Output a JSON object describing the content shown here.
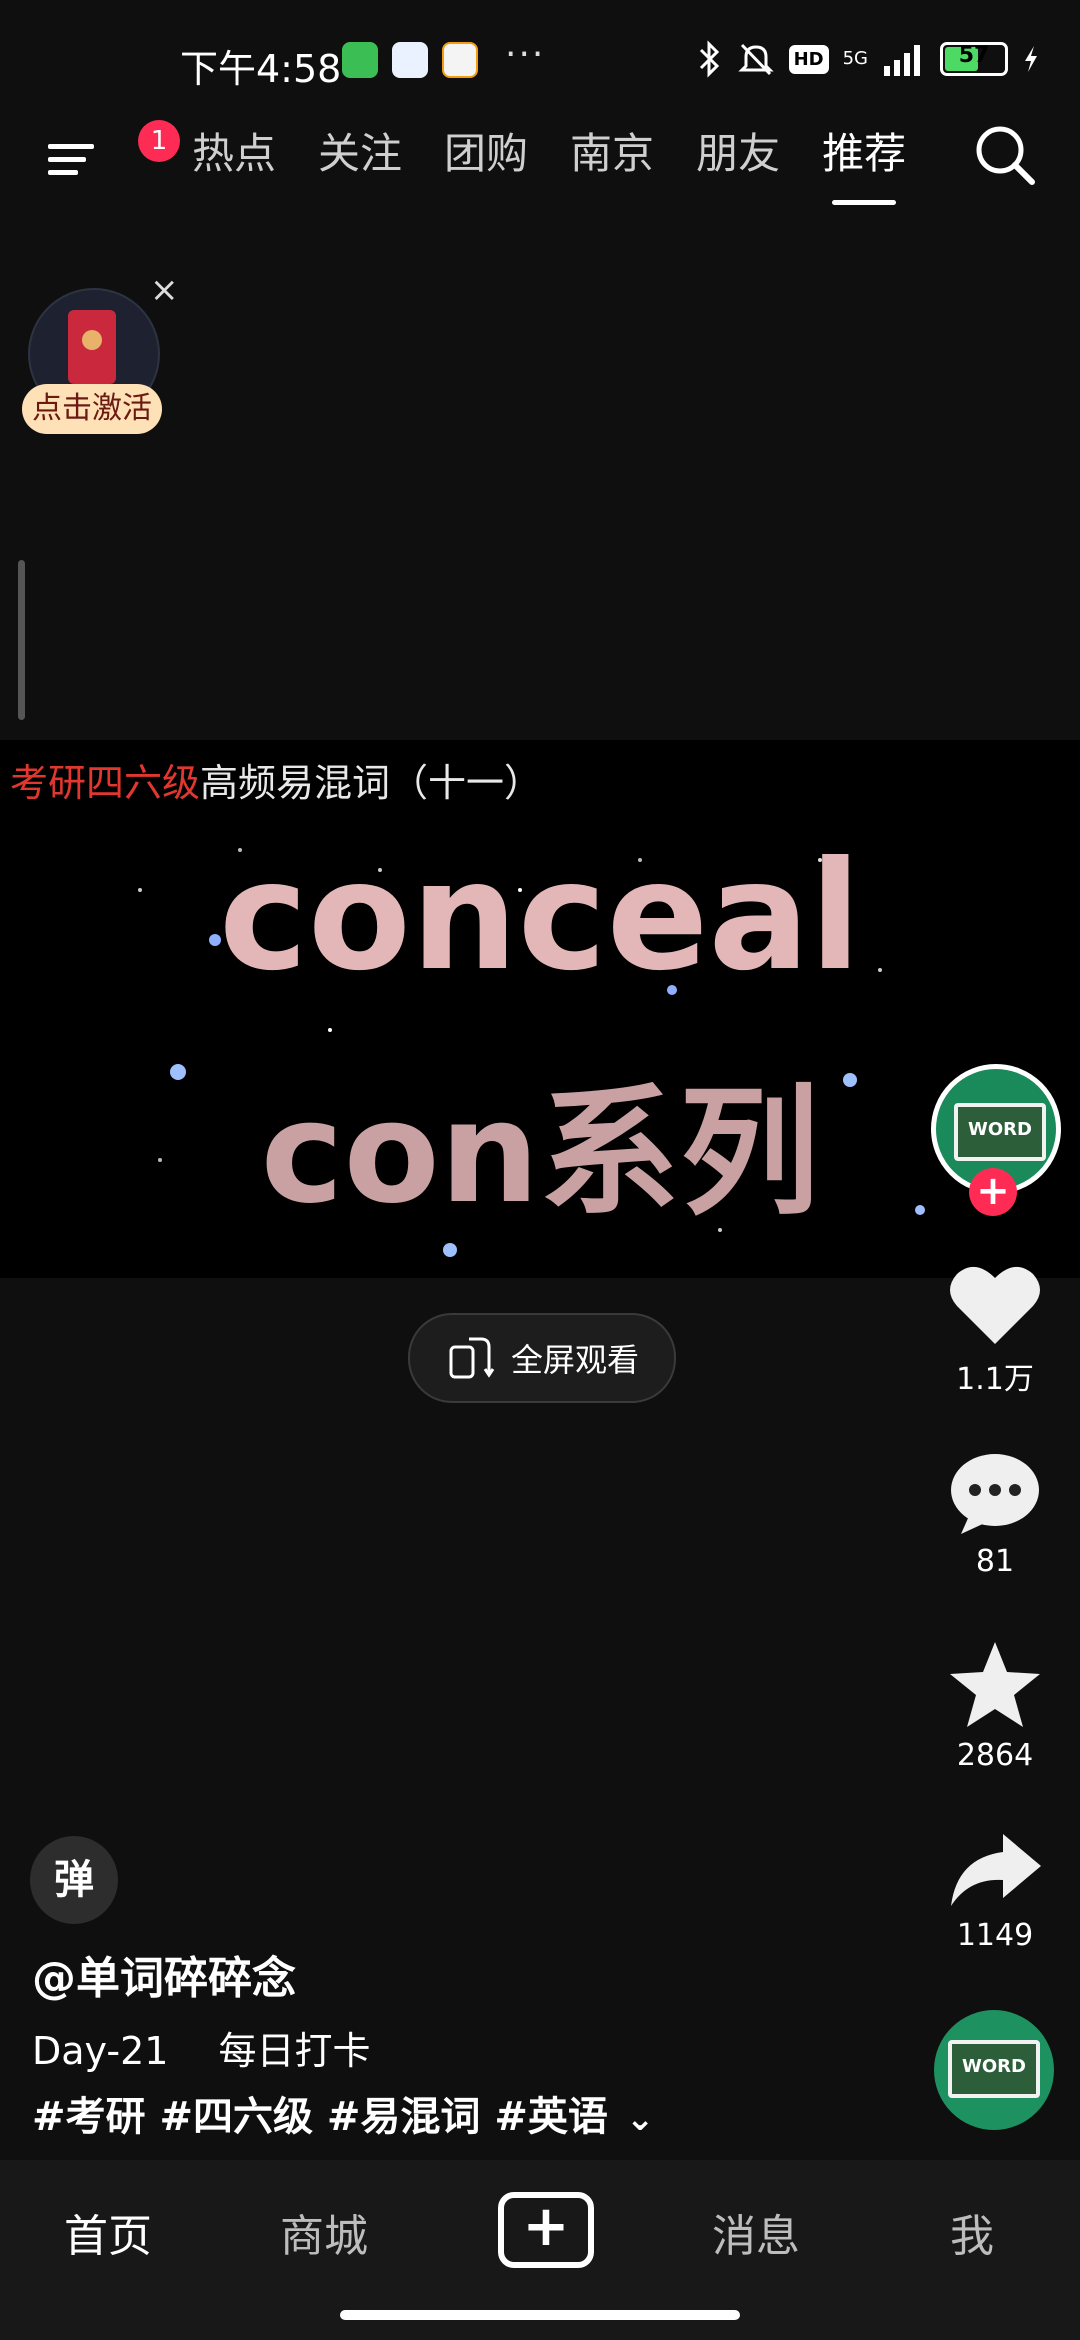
{
  "status_bar": {
    "time": "下午4:58",
    "network": "5G",
    "hd_label": "HD",
    "battery": "57",
    "battery_fraction": 0.57,
    "more": "···"
  },
  "top_nav": {
    "notification_count": "1",
    "tabs": [
      {
        "label": "热点"
      },
      {
        "label": "关注"
      },
      {
        "label": "团购"
      },
      {
        "label": "南京"
      },
      {
        "label": "朋友"
      },
      {
        "label": "推荐"
      }
    ],
    "active_tab": "推荐"
  },
  "red_packet": {
    "label": "点击激活",
    "close": "×"
  },
  "video": {
    "title_red": "考研四六级",
    "title_rest": "高频易混词（十一）",
    "word": "conceal",
    "series": "con系列",
    "fullscreen_label": "全屏观看"
  },
  "actions": {
    "avatar_text": "WORD",
    "follow": "+",
    "likes": "1.1万",
    "comments": "81",
    "favorites": "2864",
    "shares": "1149"
  },
  "post": {
    "danmu_label": "弹",
    "author": "@单词碎碎念",
    "day": "Day-21",
    "checkin": "每日打卡",
    "hashtags": "#考研 #四六级 #易混词 #英语",
    "expand": "⌄",
    "music_disc_text": "WORD"
  },
  "bottom_nav": {
    "home": "首页",
    "mall": "商城",
    "create": "+",
    "messages": "消息",
    "me": "我"
  },
  "colors": {
    "accent": "#fe2c55",
    "title_red": "#e0372f",
    "word_pink": "#e3b7b8",
    "battery_green": "#4cd964"
  }
}
